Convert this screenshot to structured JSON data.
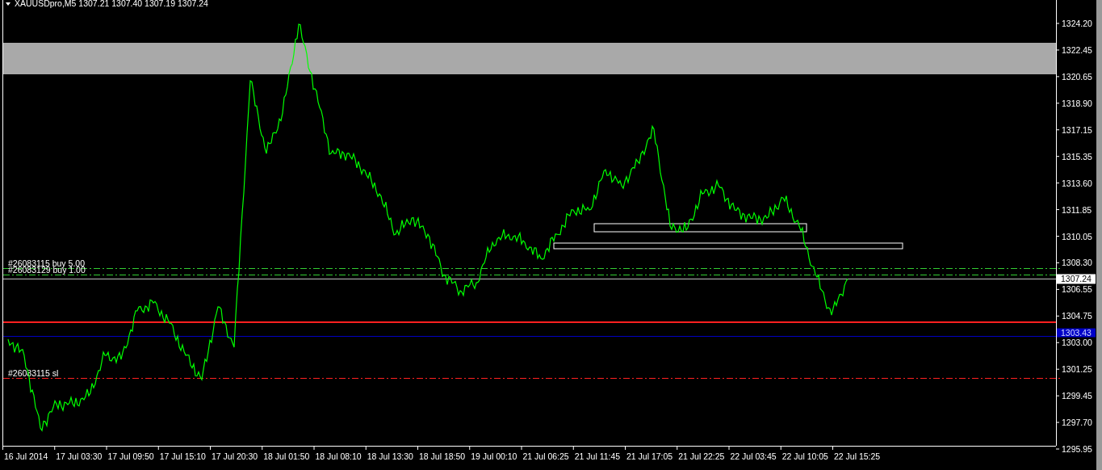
{
  "title": "XAUUSDpro,M5  1307.21 1307.40 1307.19 1307.24",
  "price_labels": [
    "1324.20",
    "1322.45",
    "1320.65",
    "1318.90",
    "1317.15",
    "1315.35",
    "1313.60",
    "1311.85",
    "1310.05",
    "1308.30",
    "1306.55",
    "1304.75",
    "1303.00",
    "1301.25",
    "1299.45",
    "1297.70",
    "1295.95"
  ],
  "time_labels": [
    "16 Jul 2014",
    "17 Jul 03:30",
    "17 Jul 09:50",
    "17 Jul 15:10",
    "17 Jul 20:30",
    "18 Jul 01:50",
    "18 Jul 08:10",
    "18 Jul 13:30",
    "18 Jul 18:50",
    "19 Jul 00:10",
    "21 Jul 06:25",
    "21 Jul 11:45",
    "21 Jul 17:05",
    "21 Jul 22:25",
    "22 Jul 03:45",
    "22 Jul 10:05",
    "22 Jul 15:25"
  ],
  "order_lines": [
    {
      "label": "#26083115 buy 5.00",
      "color": "#32cd32"
    },
    {
      "label": "#26083129 buy 1.00",
      "color": "#32cd32"
    },
    {
      "label": "#26083115 sl",
      "color": "#ff2020"
    }
  ],
  "price_markers": [
    {
      "label": "1307.24",
      "color": "#ffffff"
    },
    {
      "label": "1303.43",
      "color": "#0000c8"
    }
  ]
}
